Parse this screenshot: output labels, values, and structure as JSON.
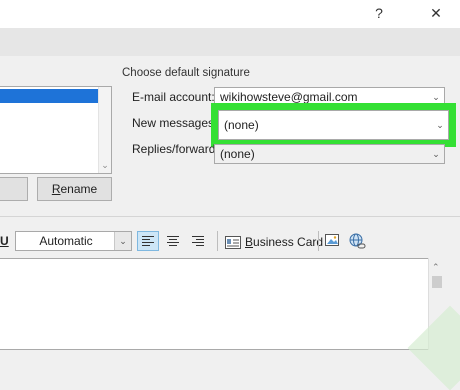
{
  "window": {
    "help_label": "?",
    "close_label": "✕"
  },
  "signatures": {
    "rename_label": "Rename",
    "rename_mnemonic": "R",
    "rename_rest": "ename"
  },
  "defaults": {
    "group_label": "Choose default signature",
    "email_label": "E-mail account:",
    "email_value": "wikihowsteve@gmail.com",
    "new_messages_label": "New messages:",
    "new_messages_value": "(none)",
    "replies_label": "Replies/forwards:",
    "replies_value": "(none)"
  },
  "editor_toolbar": {
    "underline_label": "U",
    "font_color_value": "Automatic",
    "business_card_label": "Business Card",
    "business_card_mnemonic": "B",
    "business_card_rest": "usiness Card"
  },
  "colors": {
    "highlight": "#34e034",
    "selection": "#1e73d8",
    "align_active": "#cde6f7"
  }
}
